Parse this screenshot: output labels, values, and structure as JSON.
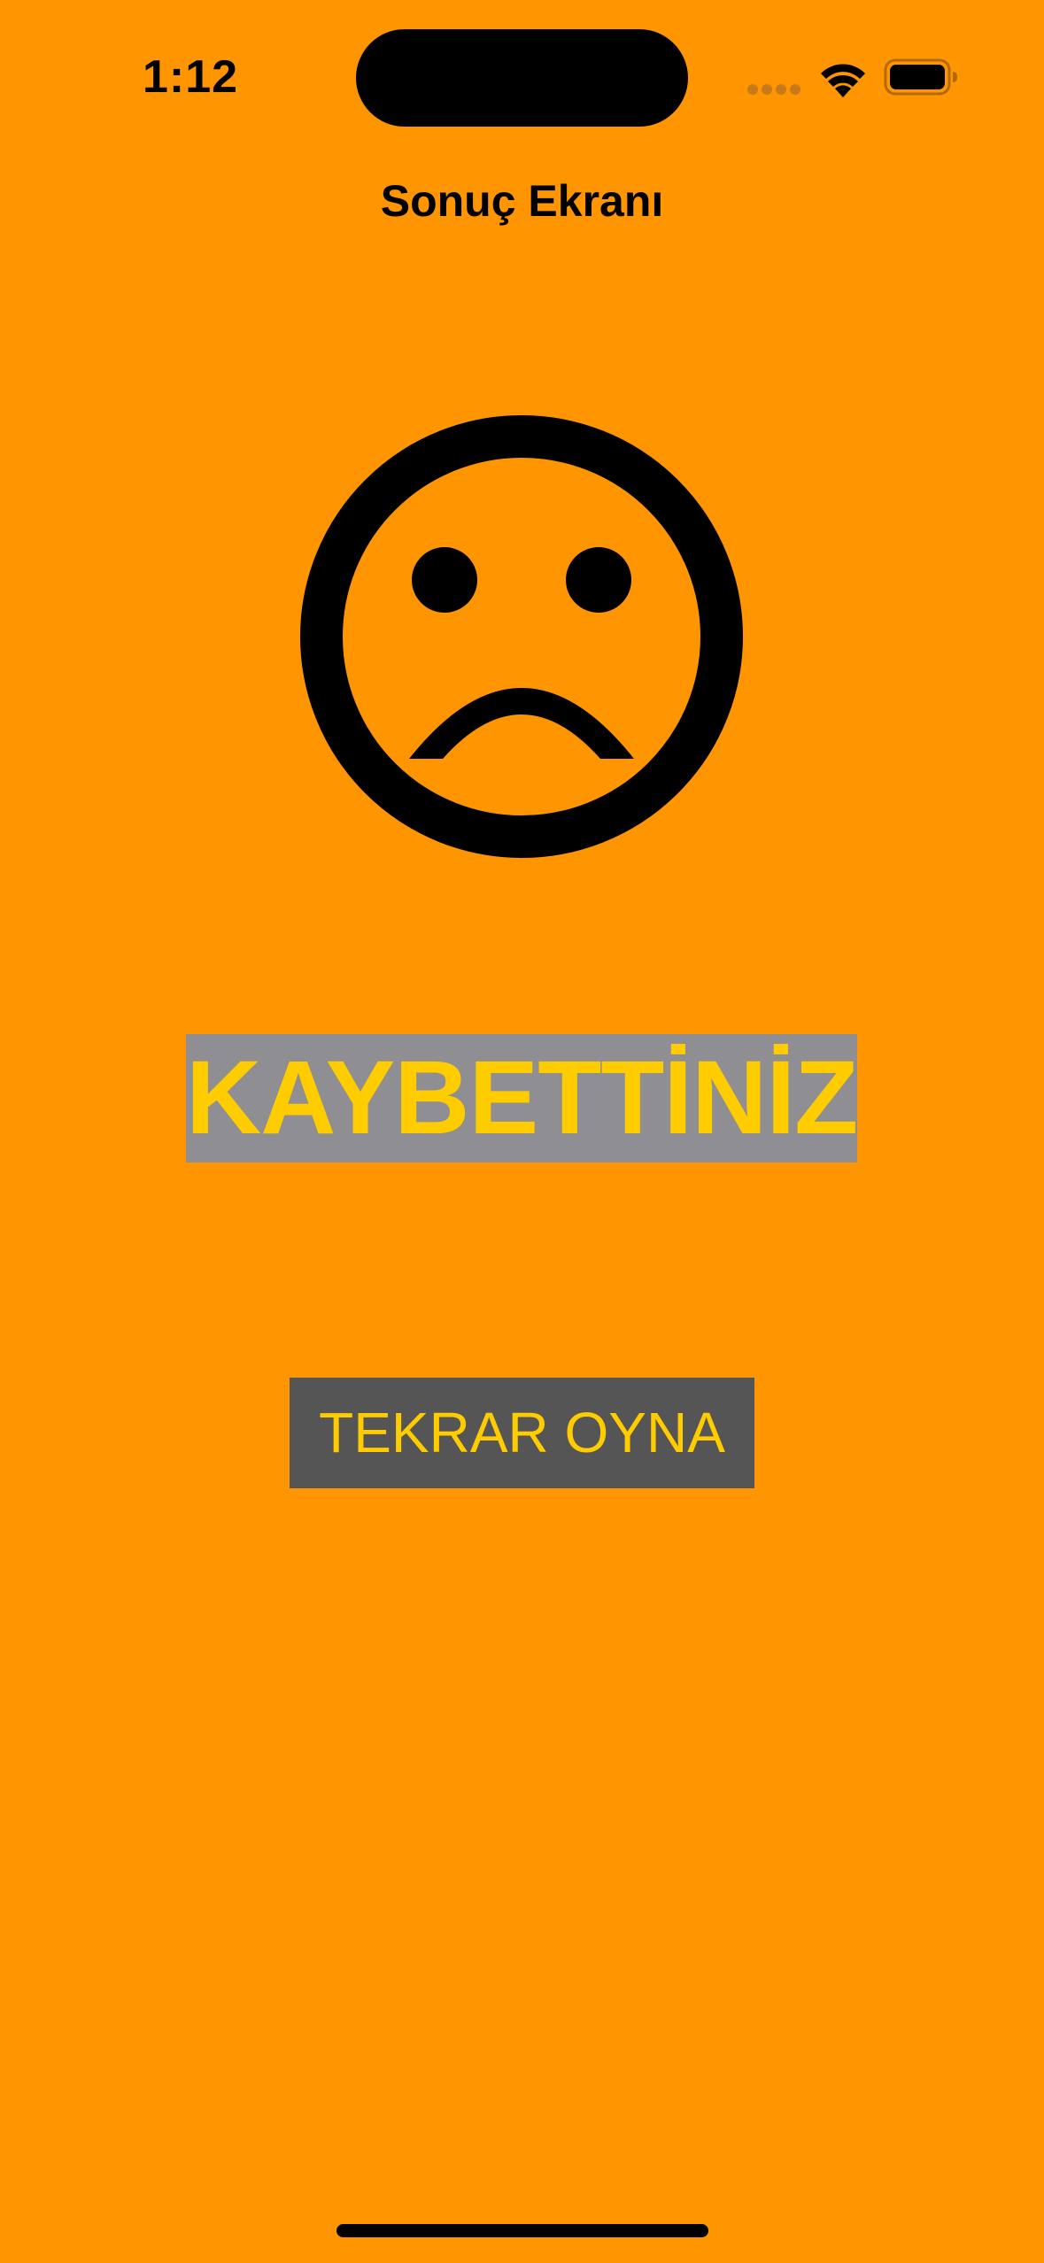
{
  "status_bar": {
    "time": "1:12",
    "signal_icon": "cellular-signal-icon",
    "wifi_icon": "wifi-icon",
    "battery_icon": "battery-icon"
  },
  "nav": {
    "title": "Sonuç Ekranı"
  },
  "result": {
    "icon": "sad-face-icon",
    "text": "KAYBETTİNİZ"
  },
  "actions": {
    "replay_label": "TEKRAR OYNA"
  },
  "colors": {
    "background": "#FF9500",
    "result_text": "#FFCC00",
    "result_background": "#8E8E93",
    "button_background": "#555555",
    "button_text": "#FFCC00"
  }
}
